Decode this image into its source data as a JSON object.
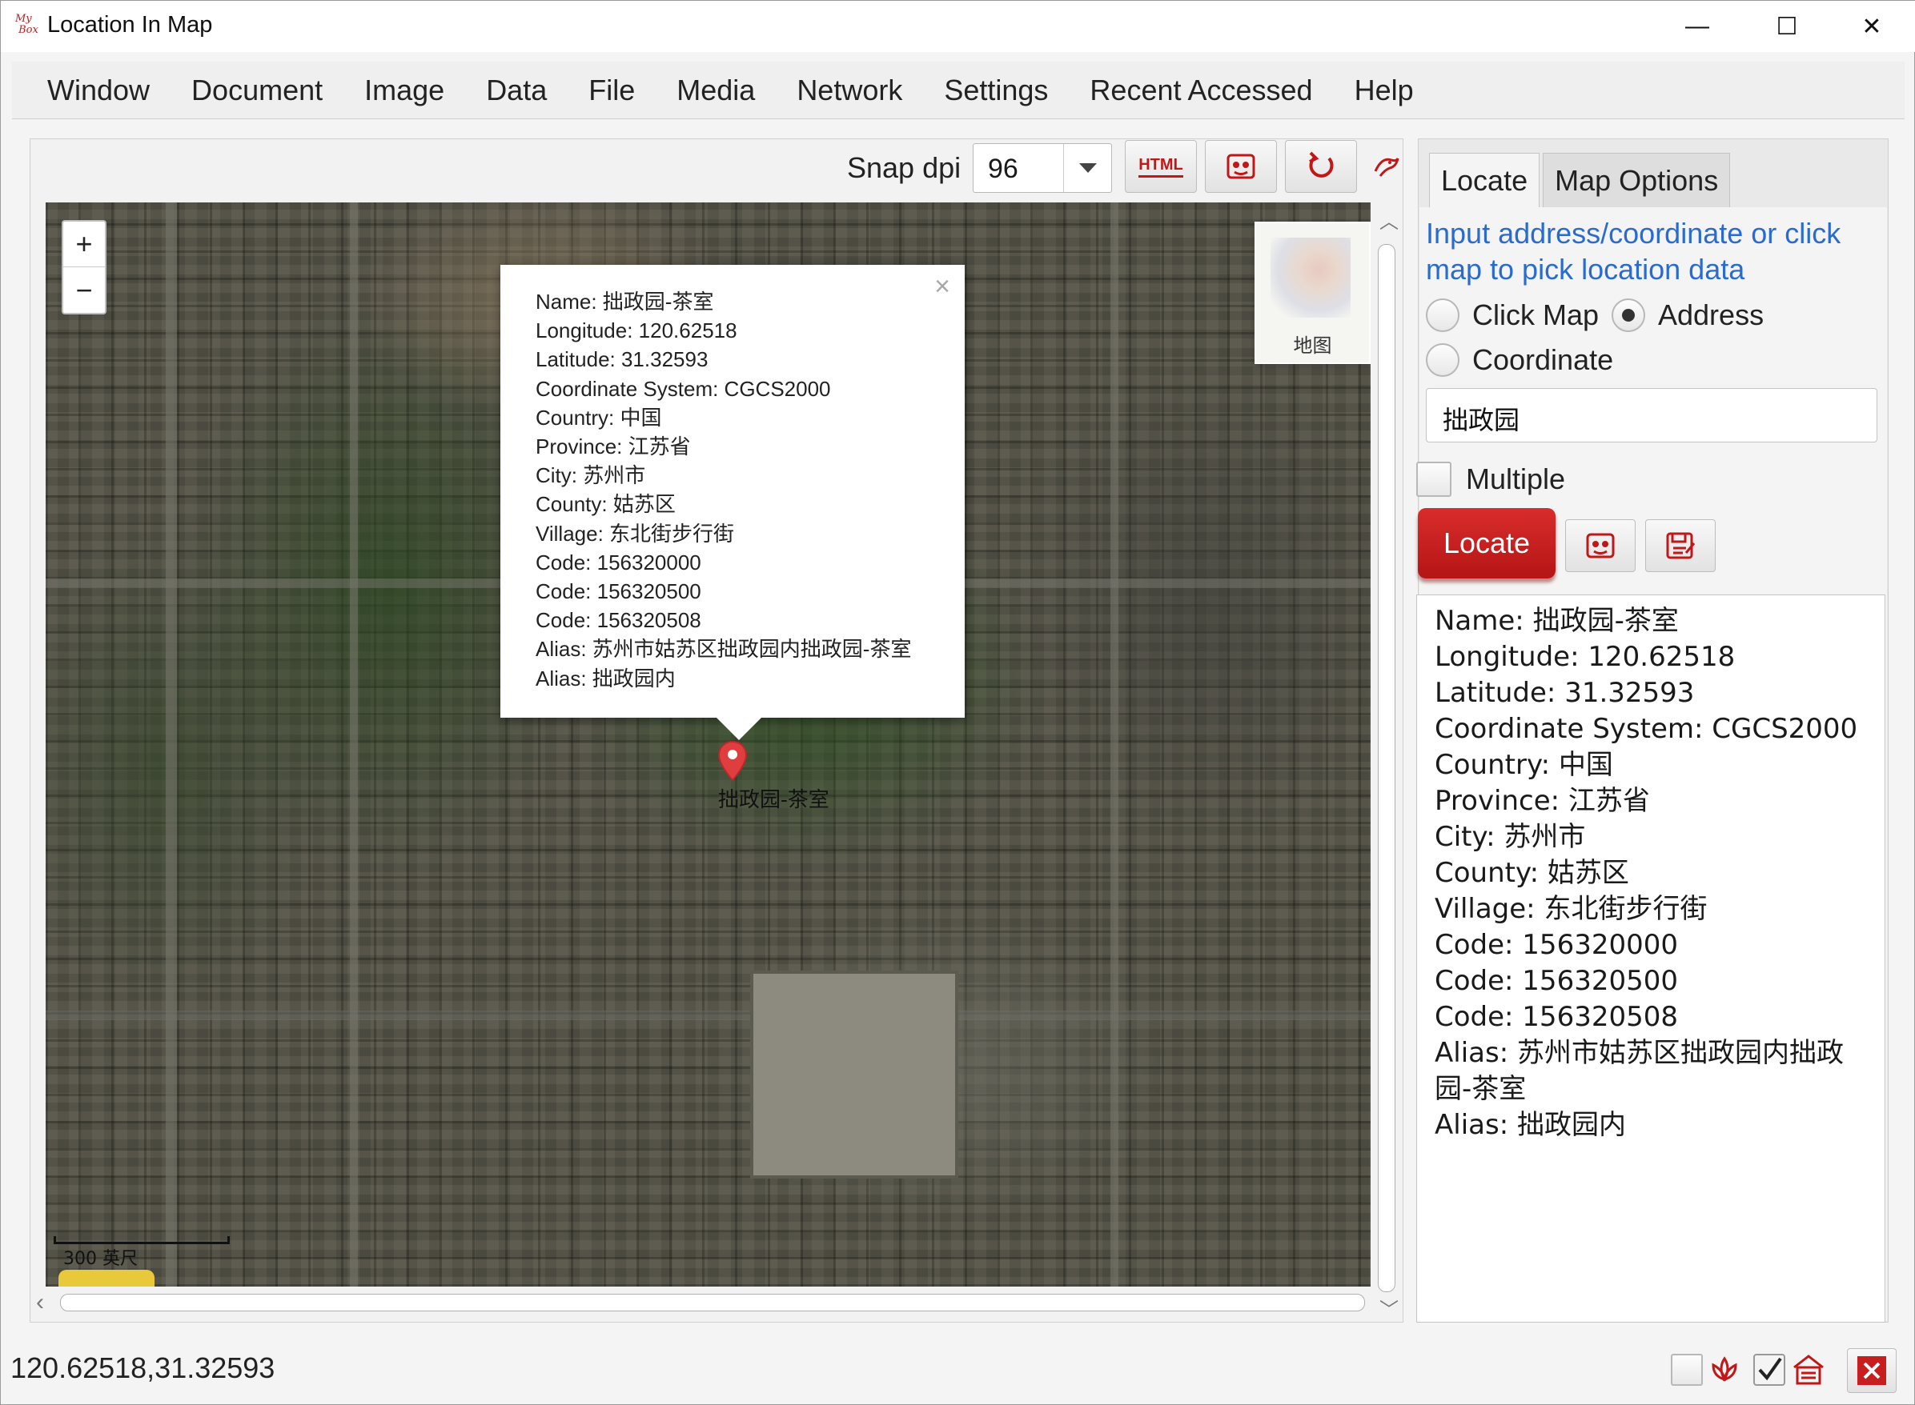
{
  "window": {
    "title": "Location In Map",
    "logo_text": "My Box",
    "minimize": "—",
    "maximize": "☐",
    "close": "✕"
  },
  "menu": [
    "Window",
    "Document",
    "Image",
    "Data",
    "File",
    "Media",
    "Network",
    "Settings",
    "Recent Accessed",
    "Help"
  ],
  "map_toolbar": {
    "snap_label": "Snap dpi",
    "dpi_value": "96",
    "html_button": "HTML"
  },
  "map": {
    "zoom_in": "+",
    "zoom_out": "−",
    "popup_close": "×",
    "popup_lines": [
      "Name: 拙政园-茶室",
      "Longitude: 120.62518",
      "Latitude: 31.32593",
      "Coordinate System: CGCS2000",
      "Country: 中国",
      "Province: 江苏省",
      "City: 苏州市",
      "County: 姑苏区",
      "Village: 东北街步行街",
      "Code: 156320000",
      "Code: 156320500",
      "Code: 156320508",
      "Alias: 苏州市姑苏区拙政园内拙政园-茶室",
      "Alias: 拙政园内"
    ],
    "marker_label": "拙政园-茶室",
    "minimap_label": "地图",
    "scale_label": "300 英尺",
    "colors": {
      "marker": "#e03e3e",
      "satellite": "#4b4a40"
    }
  },
  "side": {
    "tabs": [
      "Locate",
      "Map Options"
    ],
    "hint": "Input address/coordinate or click map to pick location data",
    "radio_click_map": "Click Map",
    "radio_address": "Address",
    "radio_coordinate": "Coordinate",
    "selected_mode": "Address",
    "address_value": "拙政园",
    "multiple_label": "Multiple",
    "multiple_checked": false,
    "locate_button": "Locate",
    "accent_color": "#c71f1f",
    "hint_color": "#2a6bd0",
    "result_lines": [
      "Name: 拙政园-茶室",
      "Longitude: 120.62518",
      "Latitude: 31.32593",
      "Coordinate System: CGCS2000",
      "Country: 中国",
      "Province: 江苏省",
      "City: 苏州市",
      "County: 姑苏区",
      "Village: 东北街步行街",
      "Code: 156320000",
      "Code: 156320500",
      "Code: 156320508",
      "Alias: 苏州市姑苏区拙政园内拙政园-茶室",
      "Alias: 拙政园内"
    ]
  },
  "status": {
    "coordinates": "120.62518,31.32593"
  }
}
